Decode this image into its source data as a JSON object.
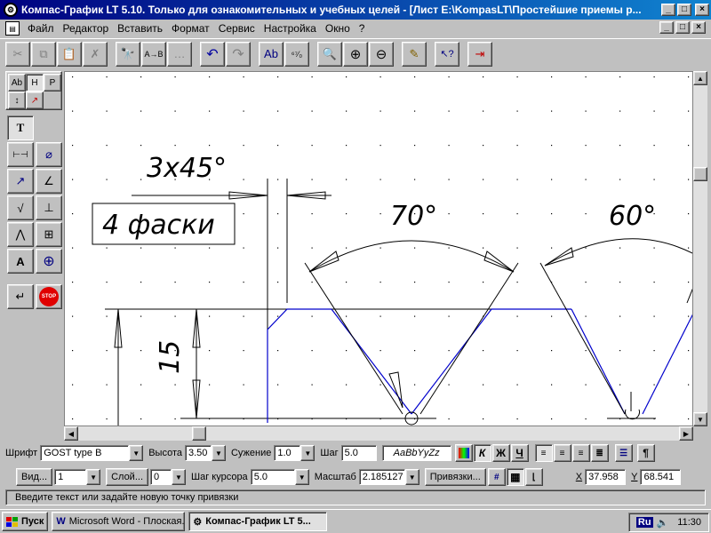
{
  "window": {
    "title": "Компас-График LT 5.10. Только для ознакомительных и учебных целей - [Лист E:\\KompasLT\\Простейшие приемы р...",
    "minimize_glyph": "_",
    "maximize_glyph": "□",
    "close_glyph": "×"
  },
  "menu": {
    "items": [
      {
        "label": "Файл"
      },
      {
        "label": "Редактор"
      },
      {
        "label": "Вставить"
      },
      {
        "label": "Формат"
      },
      {
        "label": "Сервис"
      },
      {
        "label": "Настройка"
      },
      {
        "label": "Окно"
      },
      {
        "label": "?"
      }
    ]
  },
  "toolbar": {
    "buttons": [
      {
        "icon": "scissors-icon",
        "glyph": "✂",
        "enabled": false
      },
      {
        "icon": "copy-icon",
        "glyph": "⧉",
        "enabled": false
      },
      {
        "icon": "paste-icon",
        "glyph": "📋",
        "enabled": false
      },
      {
        "icon": "delete-icon",
        "glyph": "✗",
        "enabled": false
      },
      {
        "icon": "find-icon",
        "glyph": "🔭",
        "enabled": true
      },
      {
        "icon": "replace-icon",
        "glyph": "A→B",
        "enabled": true
      },
      {
        "icon": "find-next-icon",
        "glyph": "…",
        "enabled": false
      },
      {
        "icon": "undo-icon",
        "glyph": "↶",
        "enabled": true
      },
      {
        "icon": "redo-icon",
        "glyph": "↷",
        "enabled": false
      },
      {
        "icon": "spellcheck-icon",
        "glyph": "Ab",
        "enabled": true
      },
      {
        "icon": "symbol-icon",
        "glyph": "⁶⁷⁄₀",
        "enabled": true
      },
      {
        "icon": "zoom-icon",
        "glyph": "🔍",
        "enabled": true
      },
      {
        "icon": "zoom-in-icon",
        "glyph": "⊕",
        "enabled": true
      },
      {
        "icon": "zoom-out-icon",
        "glyph": "⊖",
        "enabled": true
      },
      {
        "icon": "pencil-icon",
        "glyph": "✎",
        "enabled": true
      },
      {
        "icon": "help-pointer-icon",
        "glyph": "↖?",
        "enabled": true
      },
      {
        "icon": "exit-icon",
        "glyph": "⇥",
        "enabled": true
      }
    ]
  },
  "left_panel": {
    "tabs": [
      "Ab",
      "H",
      "P"
    ],
    "tools": [
      {
        "icon": "text-tool-icon",
        "glyph": "T"
      },
      {
        "icon": "linear-dimension-icon",
        "glyph": "⊢⊣"
      },
      {
        "icon": "diameter-icon",
        "glyph": "⌀"
      },
      {
        "icon": "radius-icon",
        "glyph": "↗"
      },
      {
        "icon": "angle-dimension-icon",
        "glyph": "∠"
      },
      {
        "icon": "roughness-icon",
        "glyph": "√"
      },
      {
        "icon": "base-icon",
        "glyph": "⊥"
      },
      {
        "icon": "leader-icon",
        "glyph": "⋀"
      },
      {
        "icon": "table-icon",
        "glyph": "⊞"
      },
      {
        "icon": "text-align-icon",
        "glyph": "A"
      },
      {
        "icon": "crosshair-icon",
        "glyph": "⊕"
      },
      {
        "icon": "enter-icon",
        "glyph": "↵"
      },
      {
        "icon": "stop-icon",
        "glyph": "STOP"
      }
    ]
  },
  "drawing": {
    "chamfer_label": "3х45°",
    "note_text": "4 фаски",
    "dim_15": "15",
    "angle_70": "70°",
    "angle_60": "60°",
    "line_color": "#0000cc",
    "grid_color": "#000000"
  },
  "format_bar": {
    "font_label": "Шрифт",
    "font_value": "GOST type B",
    "height_label": "Высота",
    "height_value": "3.50",
    "narrow_label": "Сужение",
    "narrow_value": "1.0",
    "step_label": "Шаг",
    "step_value": "5.0",
    "sample_text": "АаBbYyZz",
    "italic_btn": "К",
    "bold_btn": "Ж",
    "underline_btn": "Ч",
    "paragraph_btn": "¶"
  },
  "param_bar": {
    "view_btn": "Вид...",
    "view_value": "1",
    "layer_btn": "Слой...",
    "layer_value": "0",
    "cursor_step_label": "Шаг курсора",
    "cursor_step_value": "5.0",
    "scale_label": "Масштаб",
    "scale_value": "2.185127",
    "snap_btn": "Привязки...",
    "x_label": "X",
    "x_value": "37.958",
    "y_label": "Y",
    "y_value": "68.541"
  },
  "hint": "Введите текст или задайте новую точку привязки",
  "taskbar": {
    "start_label": "Пуск",
    "tasks": [
      {
        "label": "Microsoft Word - Плоская...",
        "icon": "word-icon"
      },
      {
        "label": "Компас-График LT 5...",
        "icon": "kompas-icon",
        "active": true
      }
    ],
    "lang": "Ru",
    "time": "11:30"
  }
}
